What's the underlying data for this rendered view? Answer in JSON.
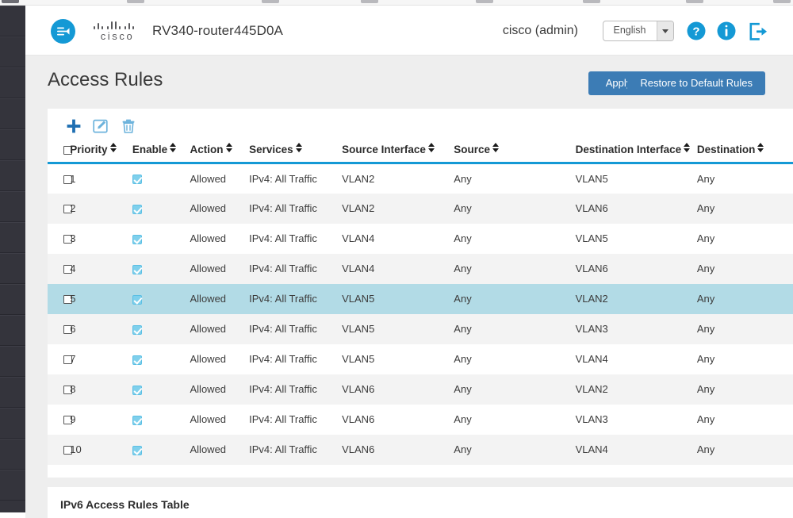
{
  "header": {
    "menu_toggle_icon": "collapse-menu-icon",
    "brand": "cisco",
    "device_name": "RV340-router445D0A",
    "user": "cisco (admin)",
    "language": "English",
    "language_options": [
      "English"
    ],
    "help_icon": "help-circle-icon",
    "info_icon": "info-circle-icon",
    "logout_icon": "logout-icon",
    "accent_color": "#1499d5"
  },
  "page": {
    "title": "Access Rules",
    "apply_label": "Apply",
    "restore_label": "Restore to Default Rules",
    "button_color": "#3c7cb5"
  },
  "toolbar": {
    "add_icon": "plus-icon",
    "edit_icon": "edit-pencil-icon",
    "delete_icon": "trash-icon",
    "add_color": "#1f6fb2",
    "edit_color": "#6db3dc",
    "delete_color": "#6db3dc"
  },
  "table": {
    "header_underline_color": "#1499d5",
    "selected_row_color": "#b2dbe6",
    "columns": [
      {
        "label": "",
        "sortable": false
      },
      {
        "label": "Priority",
        "sortable": true
      },
      {
        "label": "Enable",
        "sortable": true
      },
      {
        "label": "Action",
        "sortable": true
      },
      {
        "label": "Services",
        "sortable": true
      },
      {
        "label": "Source Interface",
        "sortable": true
      },
      {
        "label": "Source",
        "sortable": true
      },
      {
        "label": "Destination Interface",
        "sortable": true
      },
      {
        "label": "Destination",
        "sortable": true
      }
    ],
    "rows": [
      {
        "priority": "1",
        "enable": true,
        "action": "Allowed",
        "services": "IPv4: All Traffic",
        "source_interface": "VLAN2",
        "source": "Any",
        "destination_interface": "VLAN5",
        "destination": "Any",
        "selected": false
      },
      {
        "priority": "2",
        "enable": true,
        "action": "Allowed",
        "services": "IPv4: All Traffic",
        "source_interface": "VLAN2",
        "source": "Any",
        "destination_interface": "VLAN6",
        "destination": "Any",
        "selected": false
      },
      {
        "priority": "3",
        "enable": true,
        "action": "Allowed",
        "services": "IPv4: All Traffic",
        "source_interface": "VLAN4",
        "source": "Any",
        "destination_interface": "VLAN5",
        "destination": "Any",
        "selected": false
      },
      {
        "priority": "4",
        "enable": true,
        "action": "Allowed",
        "services": "IPv4: All Traffic",
        "source_interface": "VLAN4",
        "source": "Any",
        "destination_interface": "VLAN6",
        "destination": "Any",
        "selected": false
      },
      {
        "priority": "5",
        "enable": true,
        "action": "Allowed",
        "services": "IPv4: All Traffic",
        "source_interface": "VLAN5",
        "source": "Any",
        "destination_interface": "VLAN2",
        "destination": "Any",
        "selected": true
      },
      {
        "priority": "6",
        "enable": true,
        "action": "Allowed",
        "services": "IPv4: All Traffic",
        "source_interface": "VLAN5",
        "source": "Any",
        "destination_interface": "VLAN3",
        "destination": "Any",
        "selected": false
      },
      {
        "priority": "7",
        "enable": true,
        "action": "Allowed",
        "services": "IPv4: All Traffic",
        "source_interface": "VLAN5",
        "source": "Any",
        "destination_interface": "VLAN4",
        "destination": "Any",
        "selected": false
      },
      {
        "priority": "8",
        "enable": true,
        "action": "Allowed",
        "services": "IPv4: All Traffic",
        "source_interface": "VLAN6",
        "source": "Any",
        "destination_interface": "VLAN2",
        "destination": "Any",
        "selected": false
      },
      {
        "priority": "9",
        "enable": true,
        "action": "Allowed",
        "services": "IPv4: All Traffic",
        "source_interface": "VLAN6",
        "source": "Any",
        "destination_interface": "VLAN3",
        "destination": "Any",
        "selected": false
      },
      {
        "priority": "10",
        "enable": true,
        "action": "Allowed",
        "services": "IPv4: All Traffic",
        "source_interface": "VLAN6",
        "source": "Any",
        "destination_interface": "VLAN4",
        "destination": "Any",
        "selected": false
      }
    ]
  },
  "lower_section": {
    "ipv6_title": "IPv6 Access Rules Table"
  },
  "sidebar": {
    "background": "#34343c",
    "item_count": 16
  }
}
